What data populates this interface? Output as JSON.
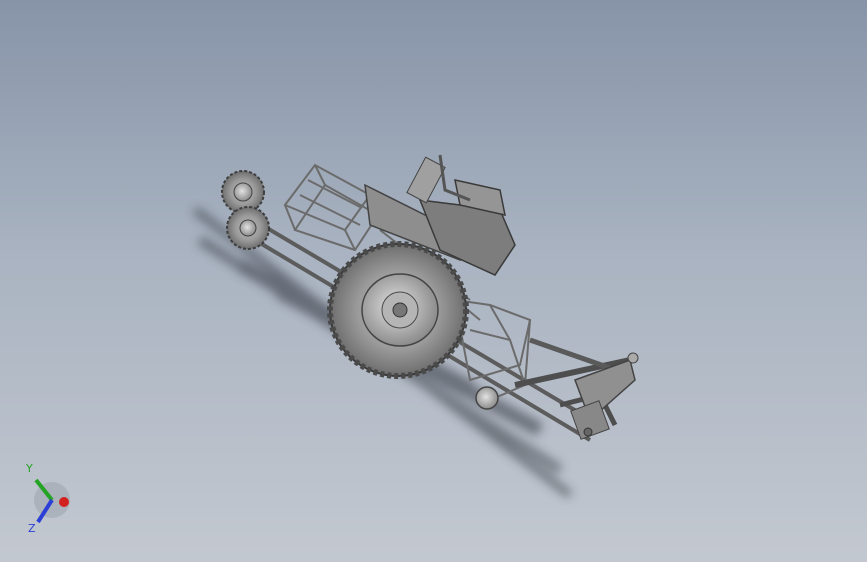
{
  "viewport": {
    "background_top": "#8794a8",
    "background_bottom": "#c3c8d0"
  },
  "model": {
    "body_color": "#8e8e8e",
    "frame_color": "#b9b9b9",
    "tire_color": "#7c7c7c"
  },
  "triad": {
    "x_color": "#d22020",
    "y_color": "#25a325",
    "z_color": "#2c3fd6",
    "y_label": "Y",
    "z_label": "Z"
  }
}
